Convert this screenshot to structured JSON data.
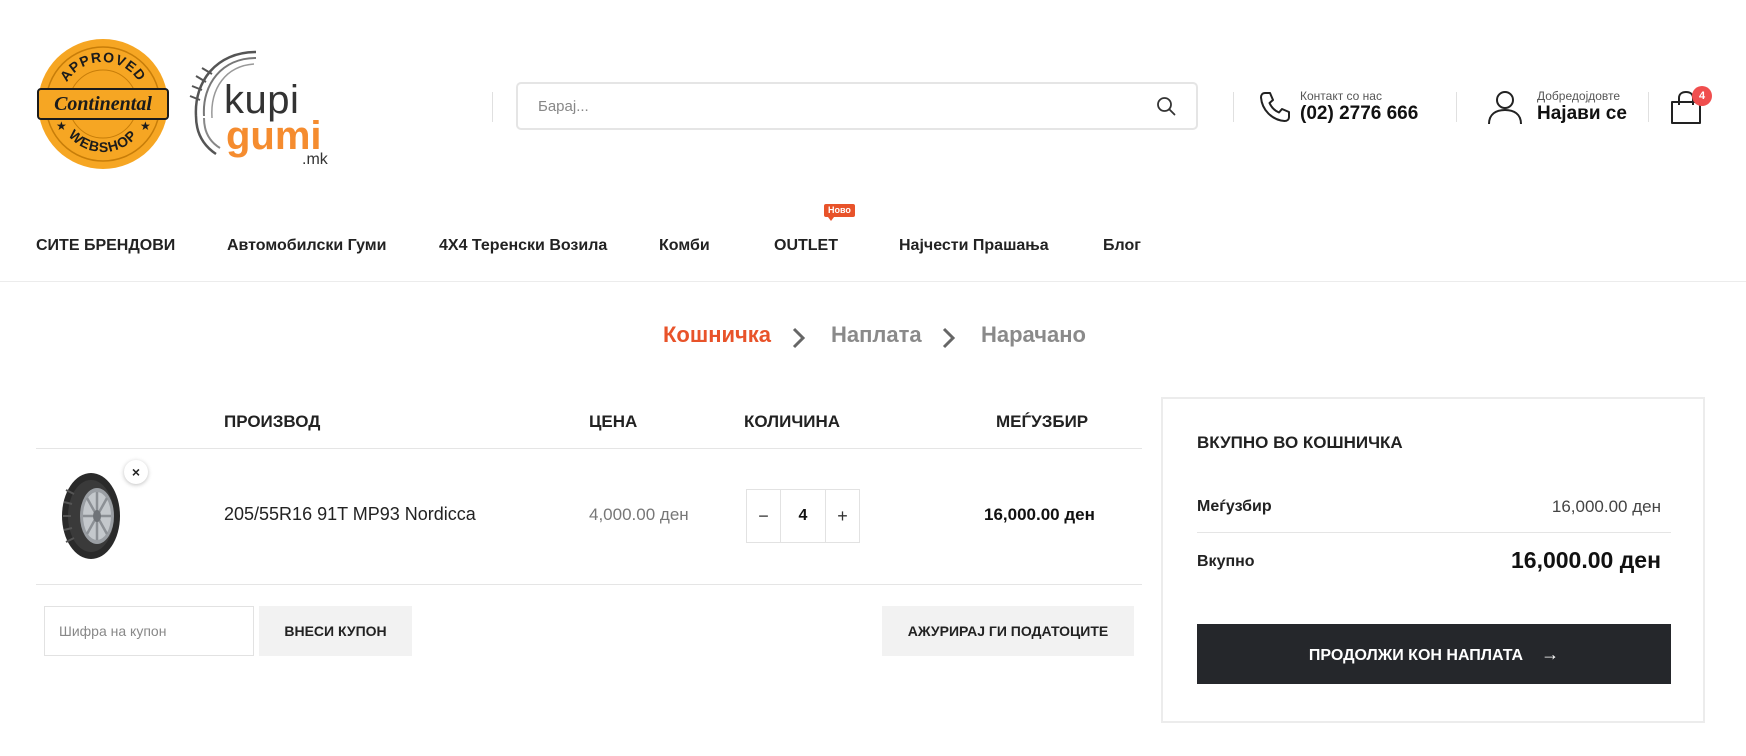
{
  "header": {
    "badge_logo": {
      "top_text": "APPROVED",
      "brand_text": "Continental",
      "bottom_text": "WEBSHOP"
    },
    "site_logo": {
      "line1": "kupi",
      "line2": "gumi",
      "suffix": ".mk"
    },
    "search": {
      "placeholder": "Барај...",
      "icon": "search-icon"
    },
    "contact": {
      "label": "Контакт со нас",
      "phone": "(02) 2776 666",
      "icon": "phone-icon"
    },
    "account": {
      "label": "Добредојдовте",
      "action": "Најави се",
      "icon": "user-icon"
    },
    "cart": {
      "count": "4",
      "icon": "shopping-bag-icon"
    }
  },
  "nav": {
    "items": [
      {
        "label": "СИТЕ БРЕНДОВИ"
      },
      {
        "label": "Автомобилски Гуми"
      },
      {
        "label": "4X4 Теренски Возила"
      },
      {
        "label": "Комби"
      },
      {
        "label": "OUTLET",
        "badge": "Ново"
      },
      {
        "label": "Најчести Прашања"
      },
      {
        "label": "Блог"
      }
    ]
  },
  "steps": {
    "items": [
      {
        "label": "Кошничка",
        "active": true
      },
      {
        "label": "Наплата",
        "active": false
      },
      {
        "label": "Нарачано",
        "active": false
      }
    ],
    "active_color": "#e8532a",
    "inactive_color": "#8a8a8a"
  },
  "cart_table": {
    "headers": {
      "product": "ПРОИЗВОД",
      "price": "ЦЕНА",
      "quantity": "КОЛИЧИНА",
      "subtotal": "МЕЃУЗБИР"
    },
    "rows": [
      {
        "name": "205/55R16 91T MP93 Nordicca",
        "price": "4,000.00 ден",
        "quantity": "4",
        "subtotal": "16,000.00 ден"
      }
    ],
    "remove_symbol": "×",
    "minus_symbol": "−",
    "plus_symbol": "+"
  },
  "coupon": {
    "placeholder": "Шифра на купон",
    "apply_label": "ВНЕСИ КУПОН",
    "update_label": "АЖУРИРАЈ ГИ ПОДАТОЦИТЕ"
  },
  "totals": {
    "title": "ВКУПНО ВО КОШНИЧКА",
    "subtotal_label": "Меѓузбир",
    "subtotal_value": "16,000.00 ден",
    "total_label": "Вкупно",
    "total_value": "16,000.00 ден",
    "checkout_label": "ПРОДОЛЖИ КОН НАПЛАТА",
    "checkout_arrow": "→"
  },
  "colors": {
    "accent": "#e8532a",
    "logo_orange": "#f58c2f",
    "badge_yellow": "#f6a623",
    "cart_badge": "#f04e4e",
    "dark_button": "#25272b"
  }
}
